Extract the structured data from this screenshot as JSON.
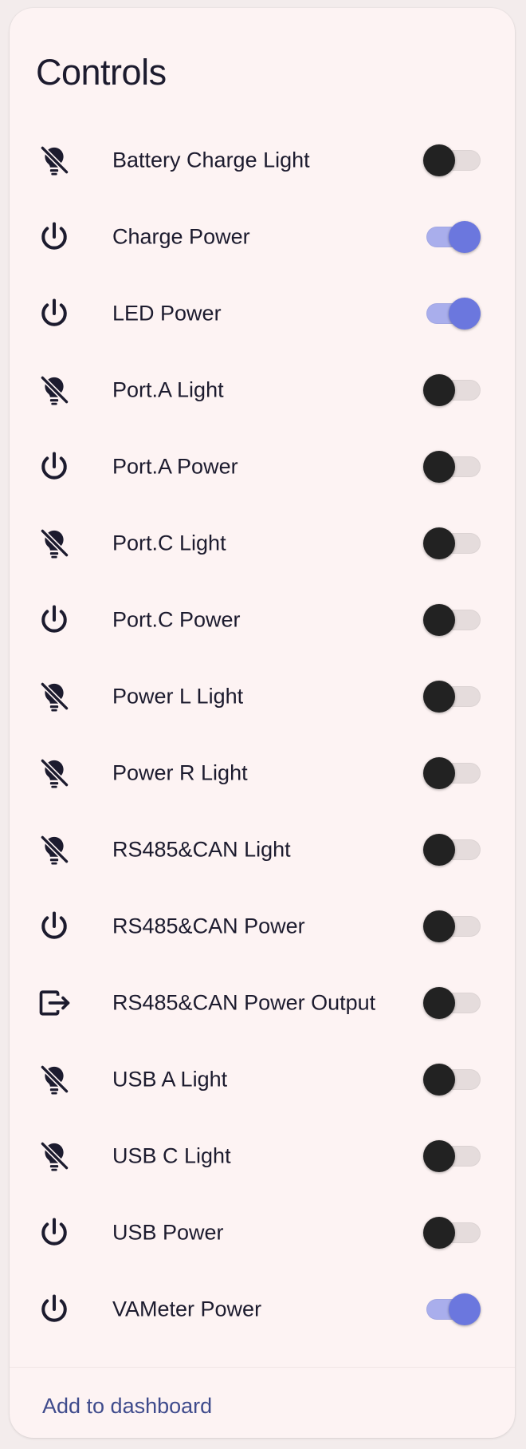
{
  "card": {
    "title": "Controls",
    "footer_action_label": "Add to dashboard"
  },
  "controls": [
    {
      "label": "Battery Charge Light",
      "icon": "lightbulb-off-icon",
      "on": false
    },
    {
      "label": "Charge Power",
      "icon": "power-icon",
      "on": true
    },
    {
      "label": "LED Power",
      "icon": "power-icon",
      "on": true
    },
    {
      "label": "Port.A Light",
      "icon": "lightbulb-off-icon",
      "on": false
    },
    {
      "label": "Port.A Power",
      "icon": "power-icon",
      "on": false
    },
    {
      "label": "Port.C Light",
      "icon": "lightbulb-off-icon",
      "on": false
    },
    {
      "label": "Port.C Power",
      "icon": "power-icon",
      "on": false
    },
    {
      "label": "Power L Light",
      "icon": "lightbulb-off-icon",
      "on": false
    },
    {
      "label": "Power R Light",
      "icon": "lightbulb-off-icon",
      "on": false
    },
    {
      "label": "RS485&CAN Light",
      "icon": "lightbulb-off-icon",
      "on": false
    },
    {
      "label": "RS485&CAN Power",
      "icon": "power-icon",
      "on": false
    },
    {
      "label": "RS485&CAN Power Output",
      "icon": "export-icon",
      "on": false
    },
    {
      "label": "USB A Light",
      "icon": "lightbulb-off-icon",
      "on": false
    },
    {
      "label": "USB C Light",
      "icon": "lightbulb-off-icon",
      "on": false
    },
    {
      "label": "USB Power",
      "icon": "power-icon",
      "on": false
    },
    {
      "label": "VAMeter Power",
      "icon": "power-icon",
      "on": true
    }
  ],
  "colors": {
    "background": "#f3ecec",
    "card": "#fdf3f3",
    "text": "#1c1b2e",
    "toggle_on_knob": "#6b77de",
    "toggle_on_track": "#a9aeec",
    "toggle_off_knob": "#222222",
    "toggle_off_track": "#e5dcdc",
    "link": "#3f4b8c"
  }
}
